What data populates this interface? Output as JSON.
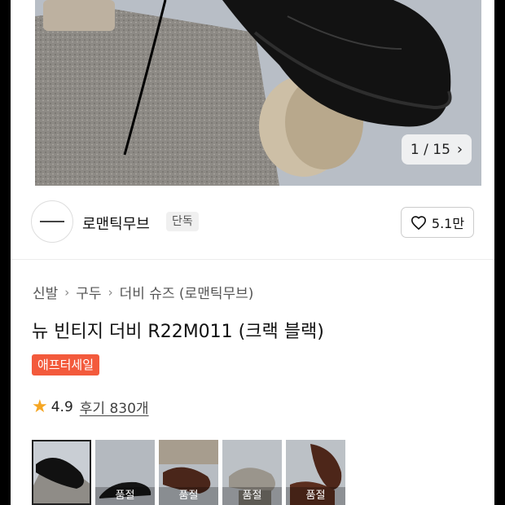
{
  "gallery": {
    "current": "1",
    "total": "15",
    "counter_text": "1 / 15",
    "next_icon": "chevron-right-icon"
  },
  "brand": {
    "name": "로맨틱무브",
    "tag": "단독",
    "likes": "5.1만",
    "like_icon": "heart-outline-icon"
  },
  "breadcrumb": [
    "신발",
    "구두",
    "더비 슈즈 (로맨틱무브)"
  ],
  "product": {
    "title": "뉴 빈티지 더비 R22M011 (크랙 블랙)",
    "badge": "애프터세일",
    "rating": "4.9",
    "review_text": "후기 830개",
    "rating_icon": "star-icon"
  },
  "thumbnails": [
    {
      "variant": "black",
      "selected": true,
      "soldout": ""
    },
    {
      "variant": "black-2",
      "selected": false,
      "soldout": "품절"
    },
    {
      "variant": "brown",
      "selected": false,
      "soldout": "품절"
    },
    {
      "variant": "grey",
      "selected": false,
      "soldout": "품절"
    },
    {
      "variant": "brown-2",
      "selected": false,
      "soldout": "품절"
    }
  ],
  "colors": {
    "sale_badge": "#f35a3c",
    "star": "#f5a623"
  }
}
